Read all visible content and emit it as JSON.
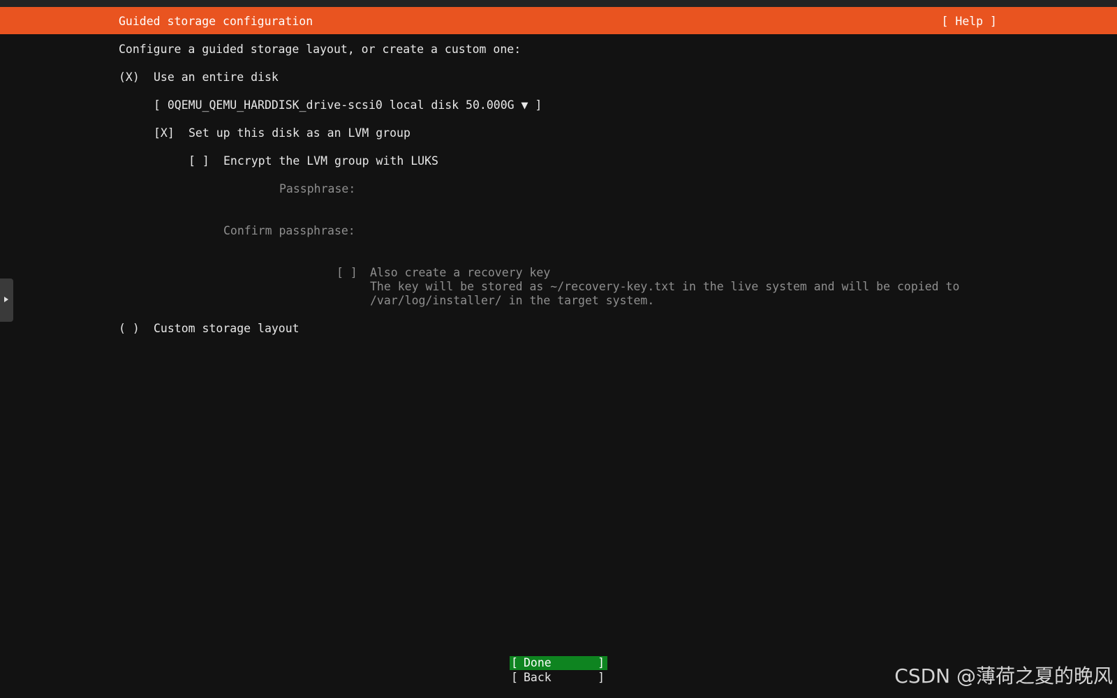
{
  "header": {
    "title": "Guided storage configuration",
    "help_label": "[ Help ]"
  },
  "intro": "Configure a guided storage layout, or create a custom one:",
  "options": {
    "entire_disk": {
      "marker": "(X)",
      "label": "Use an entire disk"
    },
    "disk_select": {
      "value": "[ 0QEMU_QEMU_HARDDISK_drive-scsi0 local disk 50.000G ▼ ]"
    },
    "lvm": {
      "marker": "[X]",
      "label": "Set up this disk as an LVM group"
    },
    "encrypt": {
      "marker": "[ ]",
      "label": "Encrypt the LVM group with LUKS"
    },
    "passphrase": {
      "label": "Passphrase:",
      "value": ""
    },
    "confirm_passphrase": {
      "label": "Confirm passphrase:",
      "value": ""
    },
    "recovery_key": {
      "marker": "[ ]",
      "label": "Also create a recovery key",
      "help_line1": "The key will be stored as ~/recovery-key.txt in the live system and will be copied to",
      "help_line2": "/var/log/installer/ in the target system."
    },
    "custom": {
      "marker": "( )",
      "label": "Custom storage layout"
    }
  },
  "buttons": {
    "done": {
      "open": "[",
      "label": "Done",
      "close": "]"
    },
    "back": {
      "open": "[",
      "label": "Back",
      "close": "]"
    }
  },
  "side_tab_icon": "triangle-right-icon",
  "watermark": "CSDN @薄荷之夏的晚风",
  "colors": {
    "header_bg": "#e95420",
    "background": "#121212",
    "done_bg": "#0e8420",
    "dim_text": "#8f8f8f"
  }
}
